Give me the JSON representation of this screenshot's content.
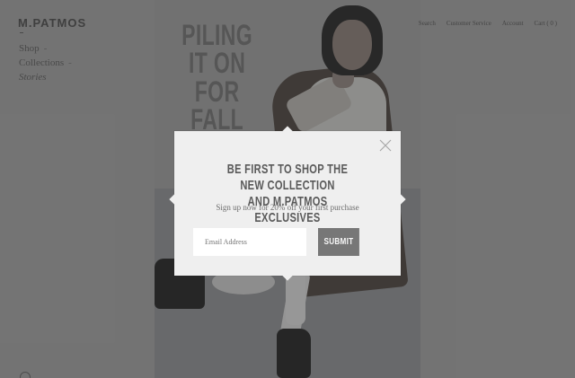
{
  "brand": {
    "logo_text": "M.PATMOS"
  },
  "left_nav": {
    "items": [
      {
        "label": "Shop",
        "dash": "-"
      },
      {
        "label": "Collections",
        "dash": "-"
      },
      {
        "label": "Stories",
        "dash": ""
      }
    ]
  },
  "top_nav": {
    "items": [
      {
        "label": "Search"
      },
      {
        "label": "Customer Service"
      },
      {
        "label": "Account"
      },
      {
        "label": "Cart ( 0 )"
      }
    ]
  },
  "hero": {
    "headline_lines": [
      "PILING",
      "IT ON",
      "FOR FALL"
    ]
  },
  "modal": {
    "title_lines": [
      "BE FIRST TO SHOP THE NEW COLLECTION",
      "AND M.PATMOS EXCLUSIVES"
    ],
    "subtitle": "Sign up now for 20% off your first purchase",
    "email_placeholder": "Email Address",
    "submit_label": "SUBMIT"
  },
  "colors": {
    "page_bg": "#7d7d7d",
    "modal_bg": "#efefef",
    "button_bg": "#777777"
  }
}
